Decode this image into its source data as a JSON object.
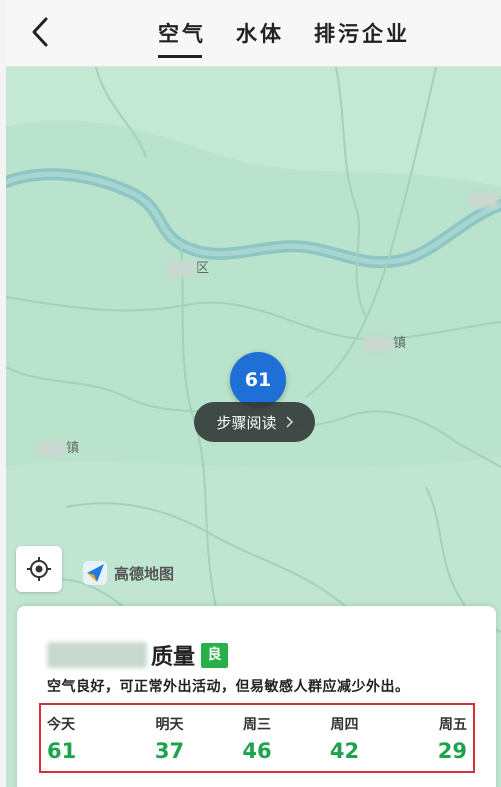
{
  "header": {
    "back_icon": "chevron-left-icon",
    "tabs": [
      {
        "label": "空气",
        "active": true
      },
      {
        "label": "水体",
        "active": false
      },
      {
        "label": "排污企业",
        "active": false
      }
    ]
  },
  "map": {
    "places": [
      {
        "suffix": "区"
      },
      {
        "suffix": "镇"
      },
      {
        "suffix": "镇"
      }
    ],
    "marker_value": "61",
    "pill_label": "步骤阅读",
    "pill_icon": "chevron-right-icon",
    "locate_icon": "locate-icon",
    "provider_label": "高德地图",
    "provider_icon": "amap-logo-icon"
  },
  "card": {
    "title": "质量",
    "level": "良",
    "description": "空气良好，可正常外出活动，但易敏感人群应减少外出。",
    "forecast": [
      {
        "label": "今天",
        "value": "61"
      },
      {
        "label": "明天",
        "value": "37"
      },
      {
        "label": "周三",
        "value": "46"
      },
      {
        "label": "周四",
        "value": "42"
      },
      {
        "label": "周五",
        "value": "29"
      }
    ]
  },
  "colors": {
    "map_bg": "#b9e3cc",
    "marker": "#1e6fd6",
    "level_badge": "#2ab04a",
    "aqi_good": "#1fa24d",
    "highlight_border": "#d6303a"
  }
}
